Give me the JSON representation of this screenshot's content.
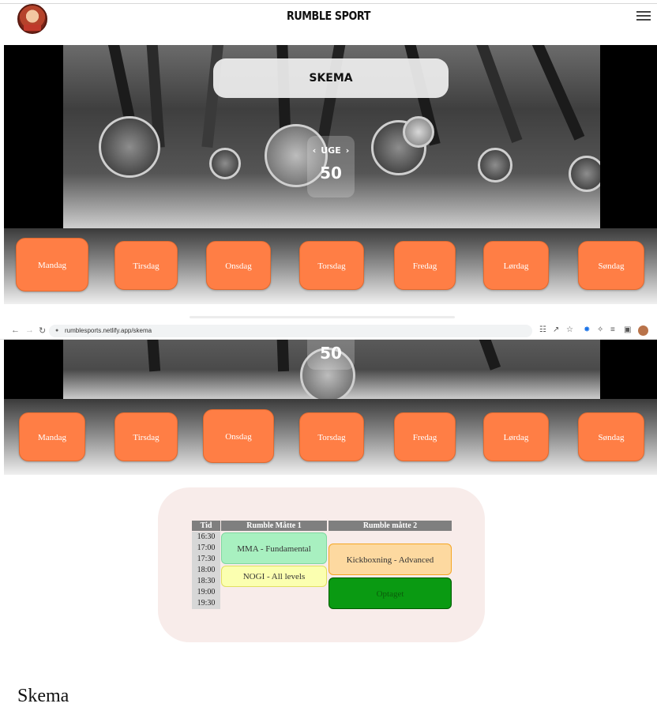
{
  "header": {
    "brand": "RUMBLE SPORT"
  },
  "hero": {
    "title": "SKEMA",
    "week_label": "UGE",
    "week_number": "50"
  },
  "days": [
    "Mandag",
    "Tirsdag",
    "Onsdag",
    "Torsdag",
    "Fredag",
    "Lørdag",
    "Søndag"
  ],
  "browser": {
    "url": "rumblesports.netlify.app/skema"
  },
  "schedule": {
    "columns": [
      "Tid",
      "Rumble Måtte 1",
      "Rumble måtte 2"
    ],
    "times": [
      "16:30",
      "17:00",
      "17:30",
      "18:00",
      "18:30",
      "19:00",
      "19:30"
    ],
    "events": [
      {
        "title": "MMA - Fundamental",
        "mat": 1,
        "color": "#a8f0c0",
        "border": "#7fd7a0"
      },
      {
        "title": "NOGI - All levels",
        "mat": 1,
        "color": "#fbffb0",
        "border": "#e0e060"
      },
      {
        "title": "Kickboxning - Advanced",
        "mat": 2,
        "color": "#fdd9a0",
        "border": "#f5a623"
      },
      {
        "title": "Optaget",
        "mat": 2,
        "color": "#0a9a12",
        "border": "#005a00"
      }
    ]
  },
  "page_title": "Skema"
}
